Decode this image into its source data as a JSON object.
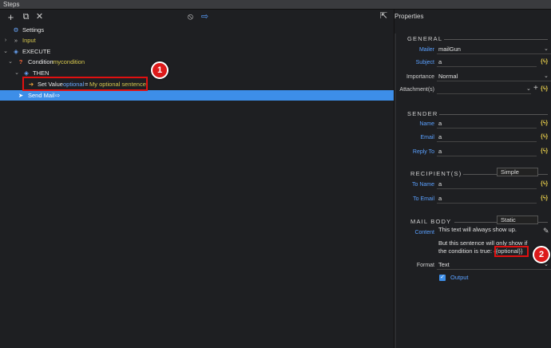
{
  "titlebar": {
    "title": "Steps"
  },
  "toolbar": {
    "add_icon": "+",
    "copy_icon": "⧉",
    "delete_icon": "✕",
    "disable_icon": "⦸",
    "export_icon": "⇨",
    "panel_icon": "⇱"
  },
  "tree": {
    "settings": "Settings",
    "input": "Input",
    "execute": "EXECUTE",
    "condition_label": "Condition",
    "condition_name": "mycondition",
    "then": "THEN",
    "setvalue_label": "Set Value",
    "setvalue_name": "optional",
    "setvalue_eq": "=",
    "setvalue_value": "My optional sentence",
    "sendmail": "Send Mail"
  },
  "badges": {
    "one": "1",
    "two": "2"
  },
  "properties": {
    "title": "Properties",
    "general": {
      "heading": "GENERAL",
      "mailer_label": "Mailer",
      "mailer_value": "mailGun",
      "subject_label": "Subject",
      "subject_value": "a",
      "importance_label": "Importance",
      "importance_value": "Normal",
      "attachments_label": "Attachment(s)",
      "attachments_value": ""
    },
    "sender": {
      "heading": "SENDER",
      "name_label": "Name",
      "name_value": "a",
      "email_label": "Email",
      "email_value": "a",
      "replyto_label": "Reply To",
      "replyto_value": "a"
    },
    "recipients": {
      "heading": "RECIPIENT(S)",
      "mode": "Simple",
      "toname_label": "To Name",
      "toname_value": "a",
      "toemail_label": "To Email",
      "toemail_value": "a"
    },
    "mailbody": {
      "heading": "MAIL BODY",
      "mode": "Static",
      "content_label": "Content",
      "content_line1": "This text will always show up.",
      "content_line2": "But this sentence will only show if",
      "content_line3a": "the condition is true:",
      "content_line3b": "{{optional}}",
      "format_label": "Format",
      "format_value": "Text",
      "output_label": "Output"
    },
    "bolt_text": "{ϟ}"
  },
  "colors": {
    "accent": "#3d8ee8",
    "badge": "#dd1a1a",
    "label_blue": "#5aa0ff",
    "variable_yellow": "#d7c84e"
  }
}
